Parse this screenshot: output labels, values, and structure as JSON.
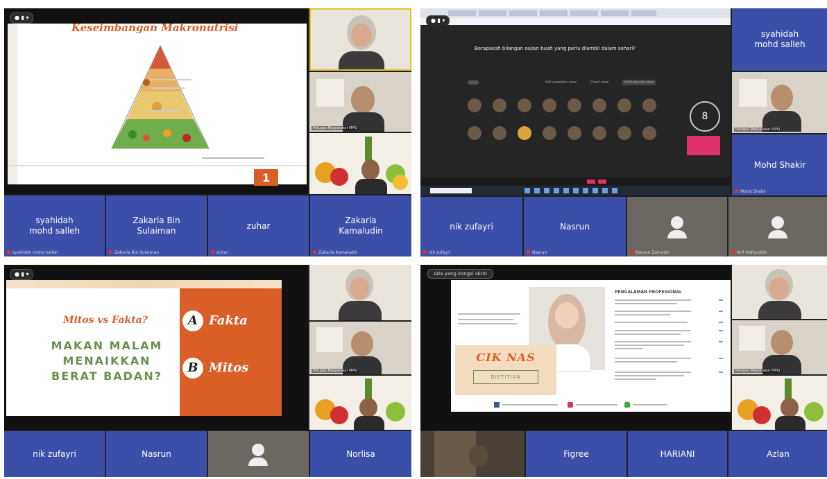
{
  "q1": {
    "slide_title": "Keseimbangan Makronutrisi",
    "slide_number": "1",
    "tiles": [
      {
        "name": "syahidah mohd salleh",
        "small": "syahidah mohd salleh"
      },
      {
        "name": "Zakaria Bin Sulaiman",
        "small": "Zakaria Bin Sulaiman"
      },
      {
        "name": "zuhar",
        "small": "zuhar"
      },
      {
        "name": "Zakaria Kamaludin",
        "small": "Zakaria Kamaludin"
      }
    ]
  },
  "q2": {
    "question": "Berapakah bilangan sajian buah yang perlu diambil dalam sehari?",
    "counter": "8",
    "tabs": [
      "Poll question view",
      "Chart view",
      "Participants view"
    ],
    "tiles_right": [
      {
        "name": "syahidah mohd salleh"
      },
      {
        "name": "Mohd Shakir",
        "small": "Mohd Shakir"
      }
    ],
    "tiles_bottom": [
      {
        "name": "nik zufayri",
        "small": "nik zufayri"
      },
      {
        "name": "Nasrun",
        "small": "Nasrun"
      },
      {
        "name": "",
        "small": "Nasrun Zainudin"
      },
      {
        "name": "",
        "small": "Arif Hafizuddin"
      }
    ]
  },
  "q3": {
    "question": "Mitos vs Fakta?",
    "statement": "MAKAN MALAM MENAIKKAN BERAT BADAN?",
    "option_a_letter": "A",
    "option_a": "Fakta",
    "option_b_letter": "B",
    "option_b": "Mitos",
    "tiles": [
      {
        "name": "nik zufayri"
      },
      {
        "name": "Nasrun"
      },
      {
        "name": ""
      },
      {
        "name": "Norlisa"
      }
    ]
  },
  "q4": {
    "banner": "Ada yang kongsi skrin",
    "slide_name": "CIK NAS",
    "slide_role": "DIETITIAN",
    "section_title": "PENGALAMAN PROFESIONAL",
    "tiles": [
      {
        "name": "Figree"
      },
      {
        "name": "HARIANI"
      },
      {
        "name": "Azlan"
      }
    ]
  },
  "colors": {
    "tile_blue": "#3b4fa8",
    "orange": "#d95f27",
    "slide_green": "#6a8f4f"
  }
}
